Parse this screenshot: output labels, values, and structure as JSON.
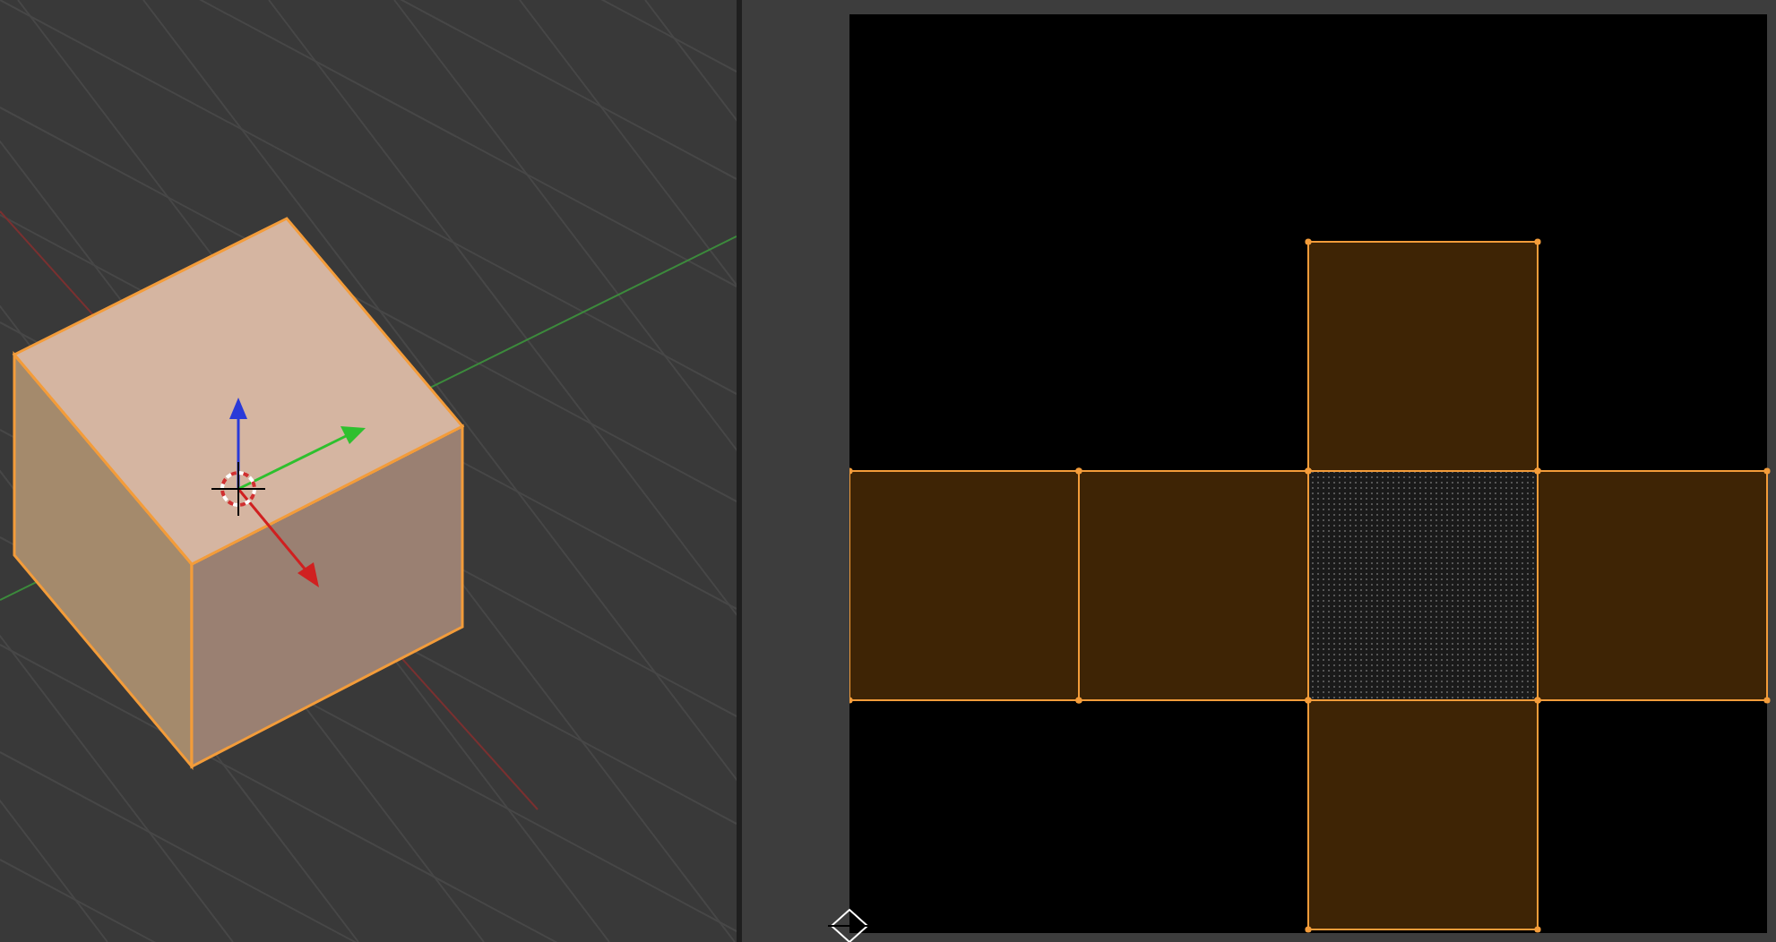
{
  "viewport": {
    "kind": "perspective",
    "object_selected": true
  },
  "uv_editor": {
    "kind": "uv_map",
    "faces": [
      {
        "selected": true,
        "active": false
      },
      {
        "selected": true,
        "active": false
      },
      {
        "selected": true,
        "active": false
      },
      {
        "selected": true,
        "active": true
      },
      {
        "selected": true,
        "active": false
      },
      {
        "selected": true,
        "active": false
      }
    ]
  }
}
